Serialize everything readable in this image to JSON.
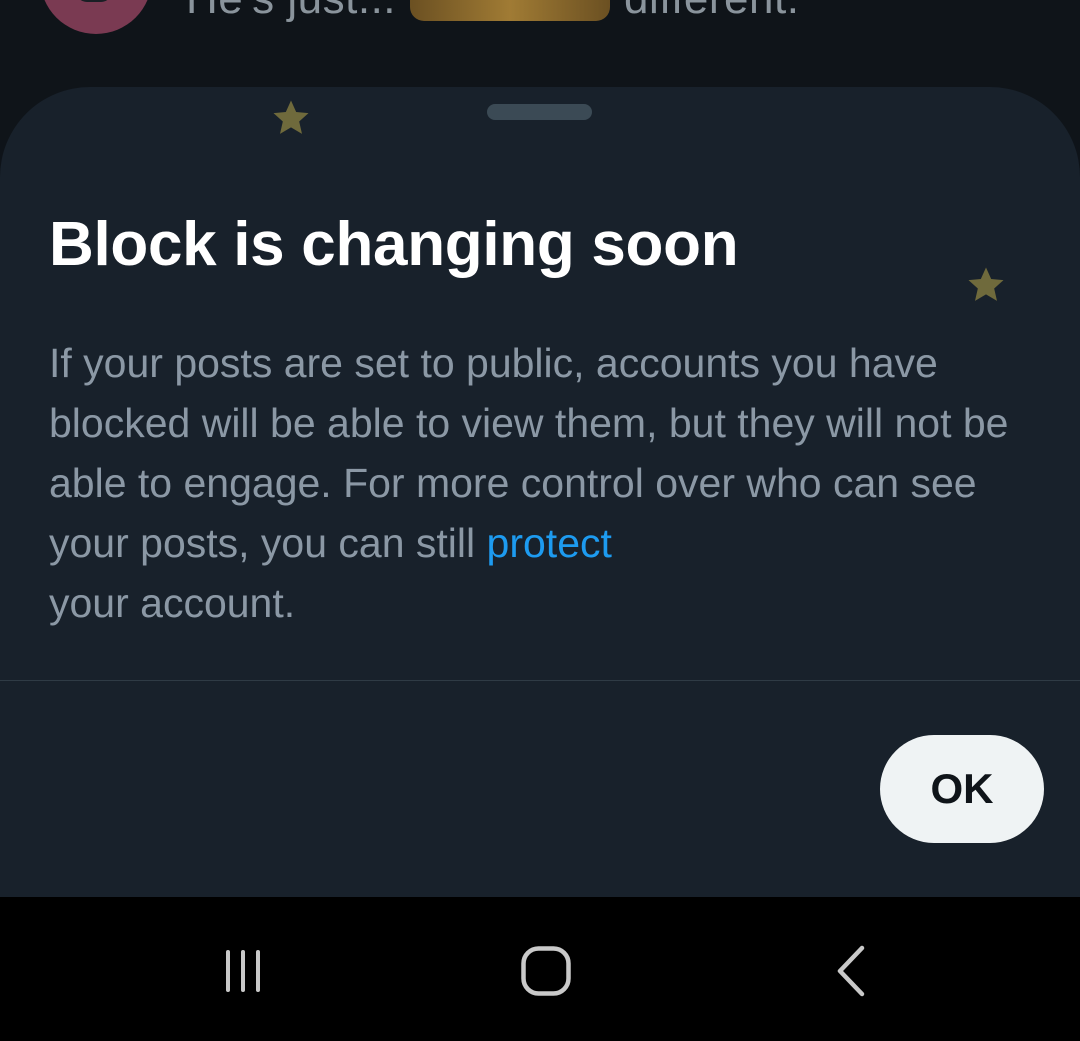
{
  "background_feed": {
    "text_before": "He's just...",
    "text_after": "different."
  },
  "sheet": {
    "title": "Block is changing soon",
    "body_text": "If your posts are set to public, accounts you have blocked will be able to view them, but they will not be able to engage. For more control over who can see your posts, you can still",
    "link_text": "protect",
    "body_text_end": "your account.",
    "ok_label": "OK"
  },
  "navbar": {
    "recents_icon": "recents-icon",
    "home_icon": "home-icon",
    "back_icon": "back-icon"
  },
  "colors": {
    "sheet_background": "#18212b",
    "title": "#ffffff",
    "body_text": "#8b98a5",
    "link": "#1d9bf0",
    "ok_button_bg": "#eff3f4",
    "star": "#6f6a3c"
  }
}
